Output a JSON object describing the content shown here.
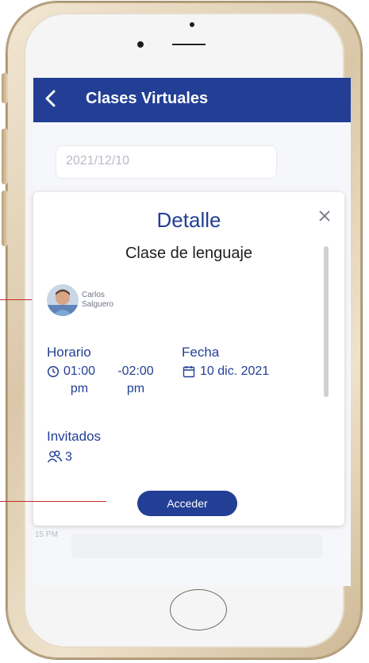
{
  "appbar": {
    "title": "Clases Virtuales",
    "back_icon": "chevron-left-icon"
  },
  "filter": {
    "date": "2021/12/10"
  },
  "background_list": {
    "time_fragment": "15 PM"
  },
  "modal": {
    "title": "Detalle",
    "class_name": "Clase de lenguaje",
    "teacher": {
      "first_name": "Carlos",
      "last_name": "Salguero"
    },
    "schedule": {
      "label": "Horario",
      "start_time": "01:00",
      "start_suffix": "pm",
      "end_time": "-02:00",
      "end_suffix": "pm"
    },
    "date": {
      "label": "Fecha",
      "value": "10 dic. 2021"
    },
    "invited": {
      "label": "Invitados",
      "count": "3"
    },
    "access_button": "Acceder"
  },
  "colors": {
    "primary": "#223f95",
    "annotation": "#c42a2a"
  }
}
